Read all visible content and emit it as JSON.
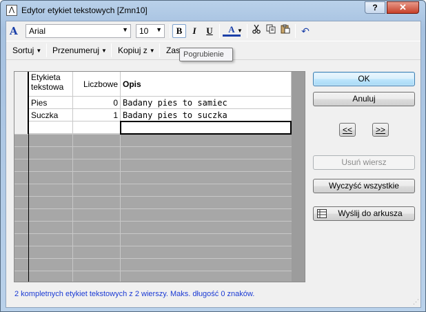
{
  "window": {
    "title": "Edytor etykiet tekstowych [Zmn10]",
    "help_label": "?",
    "close_label": "✕"
  },
  "font_toolbar": {
    "font_name": "Arial",
    "font_size": "10",
    "bold_label": "B",
    "italic_label": "I",
    "underline_label": "U",
    "font_color_label": "A"
  },
  "menu_toolbar": {
    "sort": "Sortuj",
    "renumber": "Przenumeruj",
    "copy_from": "Kopiuj z",
    "replace": "Zas"
  },
  "tooltip": "Pogrubienie",
  "grid": {
    "columns": [
      "Etykieta tekstowa",
      "Liczbowe",
      "Opis"
    ],
    "rows": [
      {
        "label": "Pies",
        "value": "0",
        "desc": "Badany pies to samiec"
      },
      {
        "label": "Suczka",
        "value": "1",
        "desc": "Badany pies to suczka"
      }
    ]
  },
  "buttons": {
    "ok": "OK",
    "cancel": "Anuluj",
    "move_left": "<<",
    "move_right": ">>",
    "delete_row": "Usuń wiersz",
    "clear_all": "Wyczyść wszystkie",
    "send_to_sheet": "Wyślij do arkusza"
  },
  "status_text": "2 kompletnych etykiet tekstowych z 2 wierszy. Maks. długość 0 znaków.",
  "colors": {
    "accent_blue": "#1a3ad4",
    "font_icon_blue": "#1a3fa8",
    "close_red": "#c7412a"
  }
}
